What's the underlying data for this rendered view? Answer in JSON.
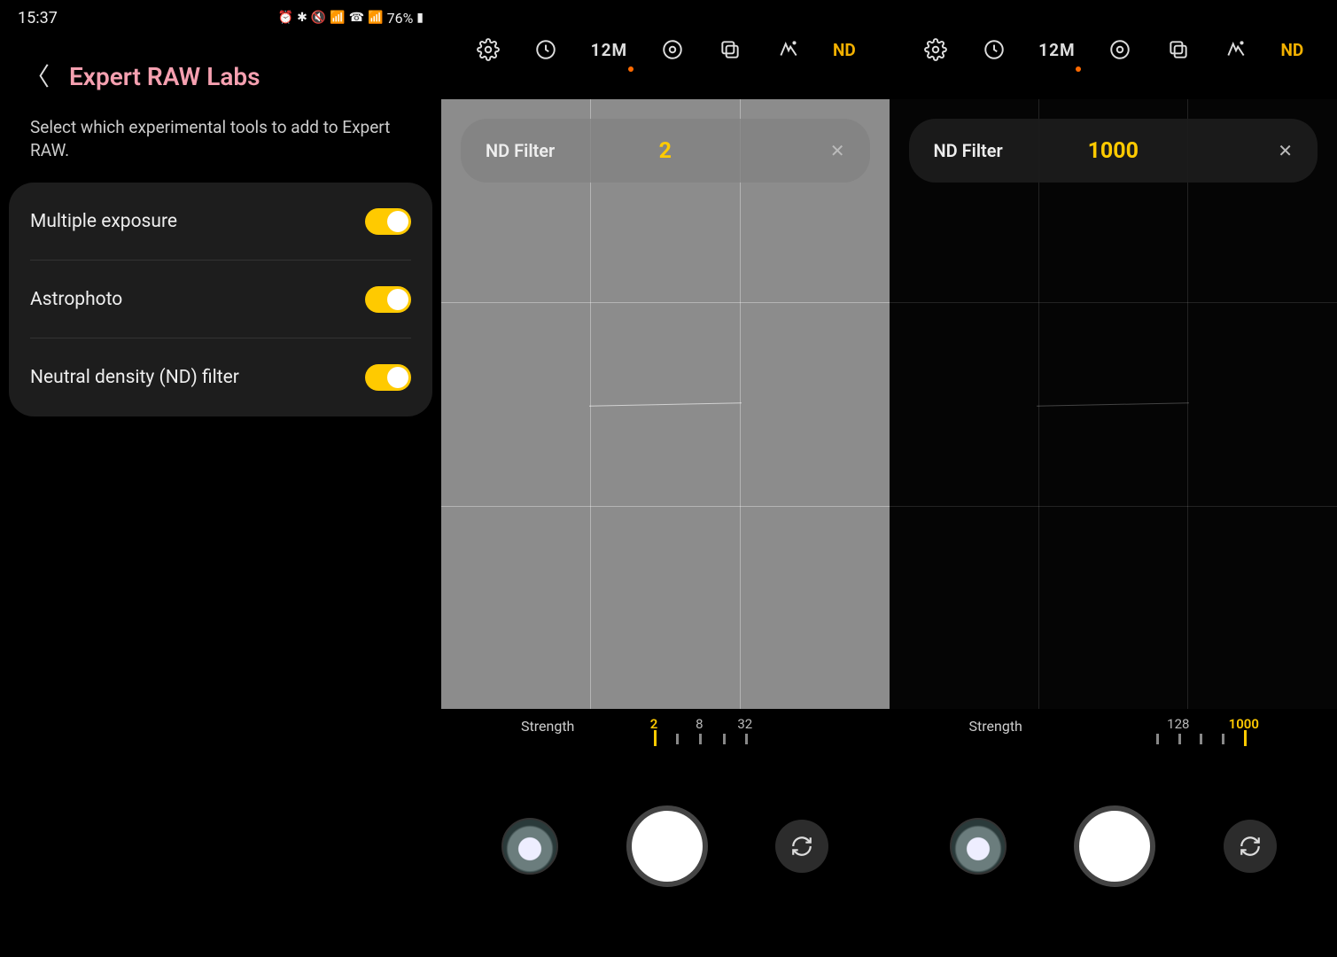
{
  "statusbar": {
    "time": "15:37",
    "battery": "76%"
  },
  "labs": {
    "title": "Expert RAW Labs",
    "description": "Select which experimental tools to add to Expert RAW.",
    "items": [
      {
        "label": "Multiple exposure",
        "enabled": true
      },
      {
        "label": "Astrophoto",
        "enabled": true
      },
      {
        "label": "Neutral density (ND) filter",
        "enabled": true
      }
    ]
  },
  "camera_topbar": {
    "resolution": "12M",
    "nd_label": "ND"
  },
  "nd_banner": {
    "label": "ND Filter",
    "close_glyph": "✕"
  },
  "panel2": {
    "nd_value": "2",
    "strength_label": "Strength",
    "ticks": [
      {
        "label": "2",
        "selected": true
      },
      {
        "label": "8",
        "selected": false
      },
      {
        "label": "32",
        "selected": false
      },
      {
        "label": "",
        "selected": false
      }
    ]
  },
  "panel3": {
    "nd_value": "1000",
    "strength_label": "Strength",
    "ticks": [
      {
        "label": "",
        "selected": false
      },
      {
        "label": "128",
        "selected": false
      },
      {
        "label": "",
        "selected": false
      },
      {
        "label": "",
        "selected": false
      },
      {
        "label": "1000",
        "selected": true
      }
    ]
  }
}
